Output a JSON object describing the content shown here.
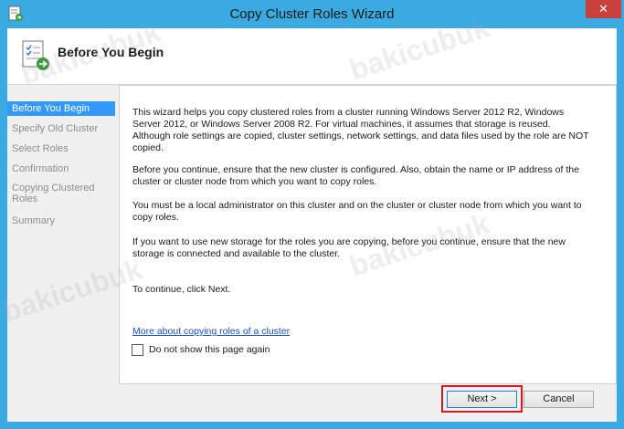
{
  "window": {
    "title": "Copy Cluster Roles Wizard",
    "close_glyph": "✕"
  },
  "header": {
    "title": "Before You Begin"
  },
  "nav": {
    "items": [
      {
        "label": "Before You Begin",
        "active": true
      },
      {
        "label": "Specify Old Cluster",
        "active": false
      },
      {
        "label": "Select Roles",
        "active": false
      },
      {
        "label": "Confirmation",
        "active": false
      },
      {
        "label": "Copying Clustered Roles",
        "active": false
      },
      {
        "label": "Summary",
        "active": false
      }
    ]
  },
  "content": {
    "paragraphs": [
      "This wizard helps you copy clustered roles from a cluster running Windows Server 2012 R2, Windows Server 2012, or Windows Server 2008 R2. For virtual machines, it assumes that storage is reused. Although role settings are copied, cluster settings, network settings, and data files used by the role are NOT copied.",
      "Before you continue, ensure that the new cluster is configured. Also, obtain the name or IP address of the cluster or cluster node from which you want to copy roles.",
      "You must be a local administrator on this cluster and on the cluster or cluster node from which you want to copy roles.",
      "If you want to use new storage for the roles you are copying, before you continue, ensure that the new storage is connected and available to the cluster.",
      "To continue, click Next."
    ],
    "link": "More about copying roles of a cluster",
    "checkbox_label": "Do not show this page again",
    "checkbox_checked": false
  },
  "buttons": {
    "next": "Next >",
    "cancel": "Cancel"
  },
  "watermark": "bakicubuk",
  "colors": {
    "frame": "#3aaae0",
    "nav_active": "#3399ff",
    "highlight": "#d7181d",
    "close": "#c7403a"
  }
}
